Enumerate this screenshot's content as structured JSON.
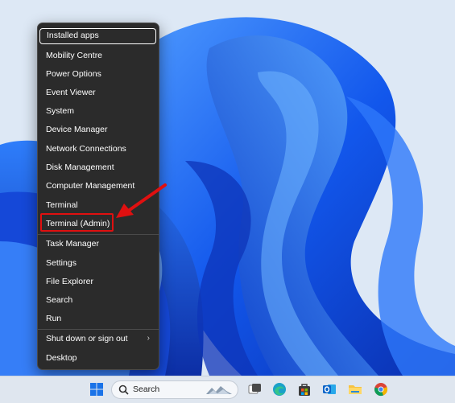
{
  "menu": {
    "items": [
      {
        "label": "Installed apps"
      },
      {
        "label": "Mobility Centre"
      },
      {
        "label": "Power Options"
      },
      {
        "label": "Event Viewer"
      },
      {
        "label": "System"
      },
      {
        "label": "Device Manager"
      },
      {
        "label": "Network Connections"
      },
      {
        "label": "Disk Management"
      },
      {
        "label": "Computer Management"
      },
      {
        "label": "Terminal"
      },
      {
        "label": "Terminal (Admin)"
      },
      {
        "label": "Task Manager"
      },
      {
        "label": "Settings"
      },
      {
        "label": "File Explorer"
      },
      {
        "label": "Search"
      },
      {
        "label": "Run"
      },
      {
        "label": "Shut down or sign out",
        "chevron": "›"
      },
      {
        "label": "Desktop"
      }
    ]
  },
  "taskbar": {
    "search_label": "Search",
    "icons": [
      "windows-start-icon",
      "search-icon",
      "task-view-icon",
      "edge-icon",
      "store-icon",
      "outlook-icon",
      "file-explorer-icon",
      "chrome-icon"
    ]
  },
  "colors": {
    "menu_bg": "#2b2b2b",
    "highlight": "#e01010",
    "wallpaper_blue": "#1a5cf0"
  }
}
